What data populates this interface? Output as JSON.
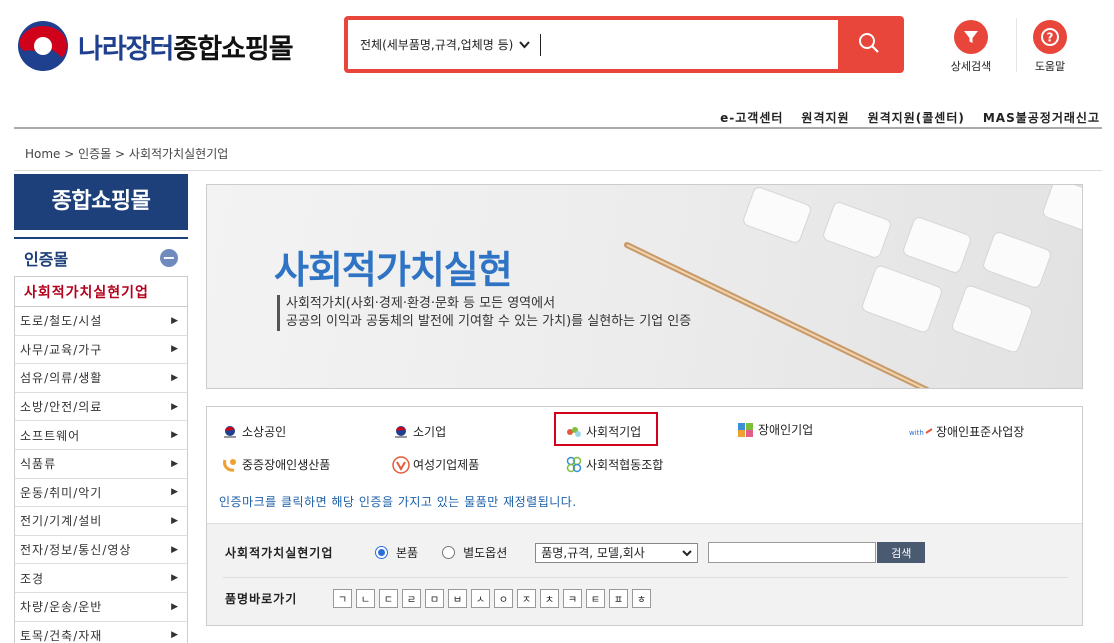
{
  "header": {
    "logo_part1": "나라장터",
    "logo_part2": "종합쇼핑몰",
    "search_scope": "전체(세부품명,규격,업체명 등)",
    "search_value": "",
    "detail_search_label": "상세검색",
    "help_label": "도움말"
  },
  "top_links": [
    "e-고객센터",
    "원격지원",
    "원격지원(콜센터)",
    "MAS불공정거래신고"
  ],
  "breadcrumb": "Home > 인증몰 > 사회적가치실현기업",
  "sidebar": {
    "title": "종합쇼핑몰",
    "category": "인증몰",
    "active_item": "사회적가치실현기업",
    "items": [
      "도로/철도/시설",
      "사무/교육/가구",
      "섬유/의류/생활",
      "소방/안전/의료",
      "소프트웨어",
      "식품류",
      "운동/취미/악기",
      "전기/기계/설비",
      "전자/정보/통신/영상",
      "조경",
      "차량/운송/운반",
      "토목/건축/자재"
    ]
  },
  "banner": {
    "title": "사회적가치실현",
    "desc_line1": "사회적가치(사회·경제·환경·문화 등 모든 영역에서",
    "desc_line2": "공공의 이익과 공동체의 발전에 기여할 수 있는 가치)를 실현하는 기업 인증"
  },
  "certs": {
    "row1": [
      "소상공인",
      "소기업",
      "사회적기업",
      "장애인기업",
      "장애인표준사업장"
    ],
    "row2": [
      "중증장애인생산품",
      "여성기업제품",
      "사회적협동조합"
    ],
    "note": "인증마크를 클릭하면 해당 인증을 가지고 있는 물품만 재정렬됩니다."
  },
  "filter": {
    "label": "사회적가치실현기업",
    "radio1": "본품",
    "radio2": "별도옵션",
    "select_value": "품명,규격, 모델,회사",
    "search_button": "검색",
    "jump_label": "품명바로가기",
    "consonants": [
      "ㄱ",
      "ㄴ",
      "ㄷ",
      "ㄹ",
      "ㅁ",
      "ㅂ",
      "ㅅ",
      "ㅇ",
      "ㅈ",
      "ㅊ",
      "ㅋ",
      "ㅌ",
      "ㅍ",
      "ㅎ"
    ]
  },
  "colors": {
    "brand_red": "#e8463a",
    "navy": "#1d3f7a",
    "banner_blue": "#2f74c4",
    "active_red": "#b3001b",
    "note_blue": "#1b5fa8"
  }
}
